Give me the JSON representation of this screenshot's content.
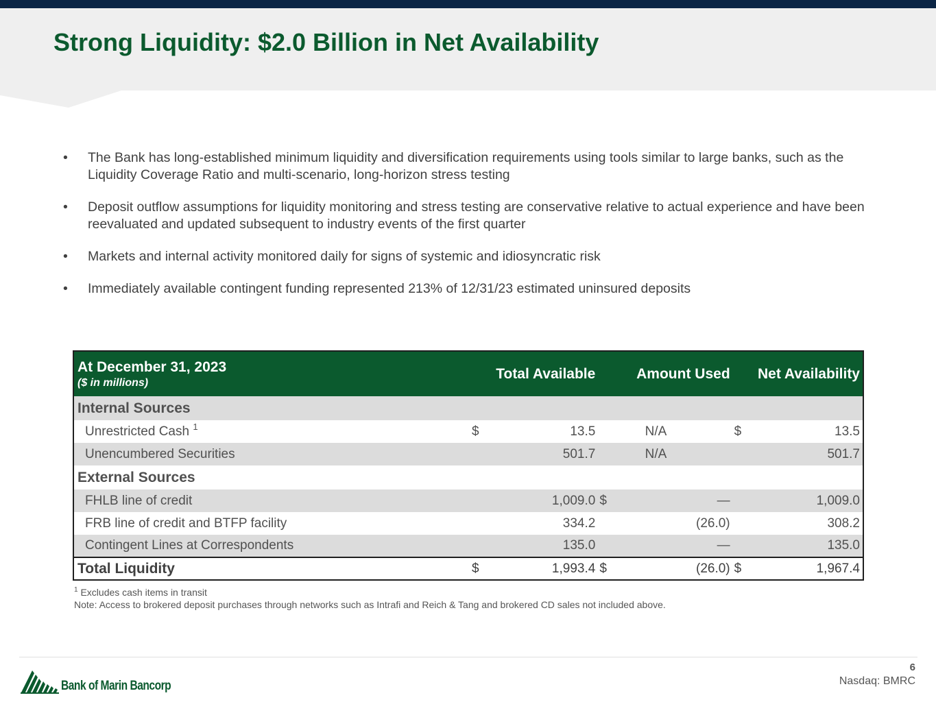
{
  "title": "Strong Liquidity: $2.0 Billion in Net Availability",
  "bullet_glyph": "•",
  "bullets": [
    "The Bank has long-established minimum liquidity and diversification requirements using tools similar to large banks, such as the Liquidity Coverage Ratio and multi-scenario, long-horizon stress testing",
    "Deposit outflow assumptions for liquidity monitoring and stress testing are conservative relative to actual experience and have been reevaluated and updated subsequent to industry events of the first quarter",
    "Markets and internal activity monitored daily for signs of systemic and idiosyncratic risk",
    "Immediately available contingent funding represented 213% of 12/31/23 estimated uninsured deposits"
  ],
  "table": {
    "header": {
      "label": "At December 31, 2023",
      "sublabel": "($ in millions)",
      "total_available": "Total Available",
      "amount_used": "Amount Used",
      "net_availability": "Net Availability"
    },
    "sections": {
      "internal": "Internal Sources",
      "external": "External Sources"
    },
    "rows": [
      {
        "label": "Unrestricted Cash",
        "sup": "1",
        "cur1": "$",
        "total": "13.5",
        "cur2": "",
        "used": "N/A",
        "cur3": "$",
        "net": "13.5"
      },
      {
        "label": "Unencumbered Securities",
        "sup": "",
        "cur1": "",
        "total": "501.7",
        "cur2": "",
        "used": "N/A",
        "cur3": "",
        "net": "501.7"
      },
      {
        "label": "FHLB line of credit",
        "sup": "",
        "cur1": "",
        "total": "1,009.0",
        "cur2": "$",
        "used": "—",
        "cur3": "",
        "net": "1,009.0"
      },
      {
        "label": "FRB line of credit and BTFP facility",
        "sup": "",
        "cur1": "",
        "total": "334.2",
        "cur2": "",
        "used": "(26.0)",
        "cur3": "",
        "net": "308.2"
      },
      {
        "label": "Contingent Lines at Correspondents",
        "sup": "",
        "cur1": "",
        "total": "135.0",
        "cur2": "",
        "used": "—",
        "cur3": "",
        "net": "135.0"
      }
    ],
    "total": {
      "label": "Total Liquidity",
      "cur1": "$",
      "total": "1,993.4",
      "cur2": "$",
      "used": "(26.0)",
      "cur3": "$",
      "net": "1,967.4"
    }
  },
  "footnotes": {
    "sup": "1",
    "note1": "Excludes cash items in transit",
    "note2": "Note: Access to brokered deposit purchases through networks such as Intrafi and Reich & Tang and brokered CD sales not included above."
  },
  "footer": {
    "logo_text": "Bank of Marin Bancorp",
    "page_number": "6",
    "ticker": "Nasdaq: BMRC"
  },
  "colors": {
    "brand_green": "#0b5a2e",
    "top_bar_navy": "#0b2545",
    "header_band": "#efefef",
    "row_grey": "#dcdcdc"
  },
  "icons": {
    "logo": "mountain-stripes-logo-icon"
  }
}
